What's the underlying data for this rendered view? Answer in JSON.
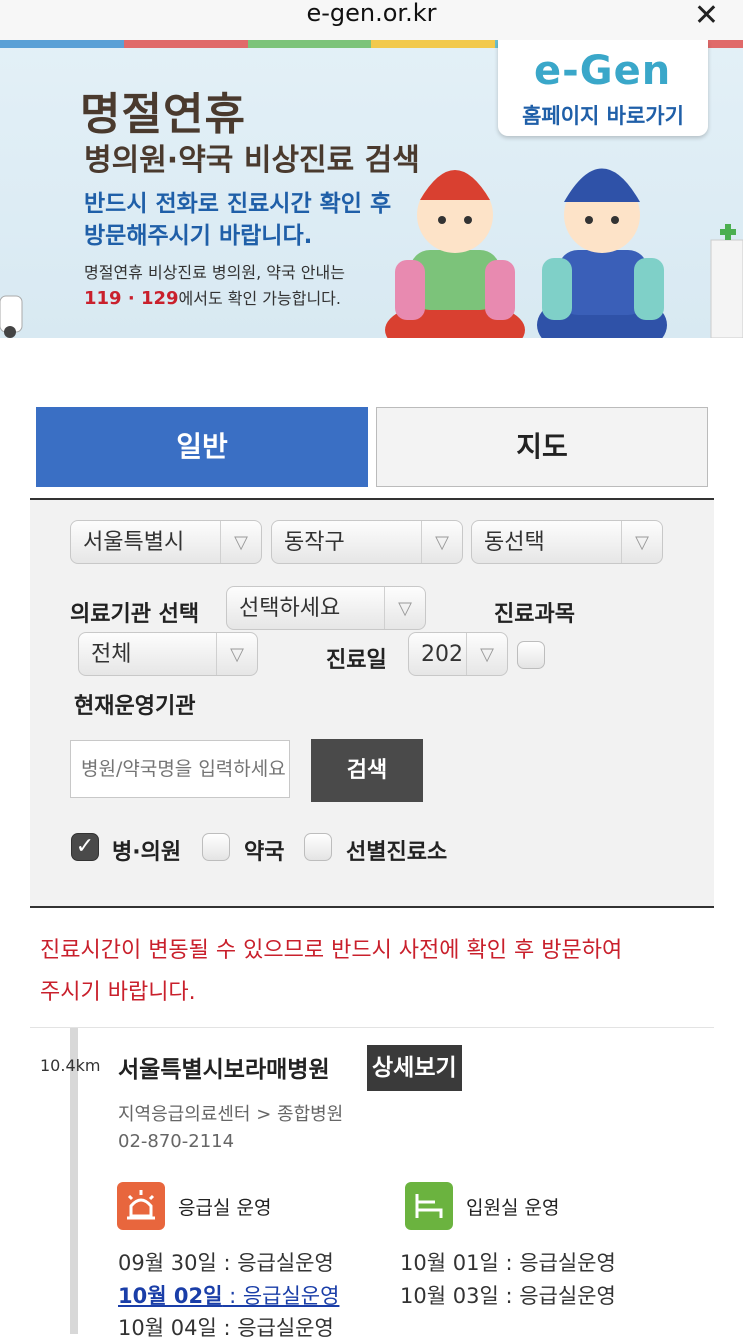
{
  "browser": {
    "url": "e-gen.or.kr",
    "close": "✕"
  },
  "banner": {
    "title": "명절연휴",
    "subtitle": "병의원·약국 비상진료 검색",
    "message_line1": "반드시 전화로 진료시간 확인 후",
    "message_line2": "방문해주시기 바랍니다.",
    "info_line1": "명절연휴 비상진료 병의원, 약국 안내는",
    "info_numbers": "119 · 129",
    "info_suffix": "에서도 확인 가능합니다.",
    "home_logo": "e-Gen",
    "home_button": "홈페이지 바로가기",
    "stripe_colors": [
      "#5aa0d6",
      "#e06a6a",
      "#7cc37a",
      "#f2c94c",
      "#6cc0d0",
      "#e06a6a"
    ]
  },
  "tabs": [
    {
      "label": "일반",
      "active": true
    },
    {
      "label": "지도",
      "active": false
    }
  ],
  "filters": {
    "city": "서울특별시",
    "district": "동작구",
    "dong": "동선택",
    "institution_label": "의료기관 선택",
    "institution_value": "선택하세요",
    "department_label": "진료과목",
    "department_value": "전체",
    "date_label": "진료일",
    "date_value": "202",
    "current_label": "현재운영기관",
    "search_placeholder": "병원/약국명을 입력하세요",
    "search_button": "검색",
    "types": [
      {
        "label": "병·의원",
        "checked": true
      },
      {
        "label": "약국",
        "checked": false
      },
      {
        "label": "선별진료소",
        "checked": false
      }
    ]
  },
  "notice": {
    "line1": "진료시간이 변동될 수 있으므로 반드시 사전에 확인 후 방문하여",
    "line2": "주시기 바랍니다."
  },
  "result": {
    "distance": "10.4km",
    "name": "서울특별시보라매병원",
    "detail_button": "상세보기",
    "category": "지역응급의료센터 > 종합병원",
    "phone": "02-870-2114",
    "services": [
      {
        "icon": "siren-icon",
        "label": "응급실 운영",
        "color": "#e8663d"
      },
      {
        "icon": "bed-icon",
        "label": "입원실 운영",
        "color": "#6bb33f"
      }
    ],
    "schedule": [
      {
        "date": "09월 30일",
        "text": " : 응급실운영"
      },
      {
        "date": "10월 01일",
        "text": " : 응급실운영"
      },
      {
        "date": "10월 02일",
        "text": " : 응급실운영"
      },
      {
        "date": "10월 03일",
        "text": " : 응급실운영"
      },
      {
        "date": "10월 04일",
        "text": " : 응급실운영"
      }
    ]
  }
}
